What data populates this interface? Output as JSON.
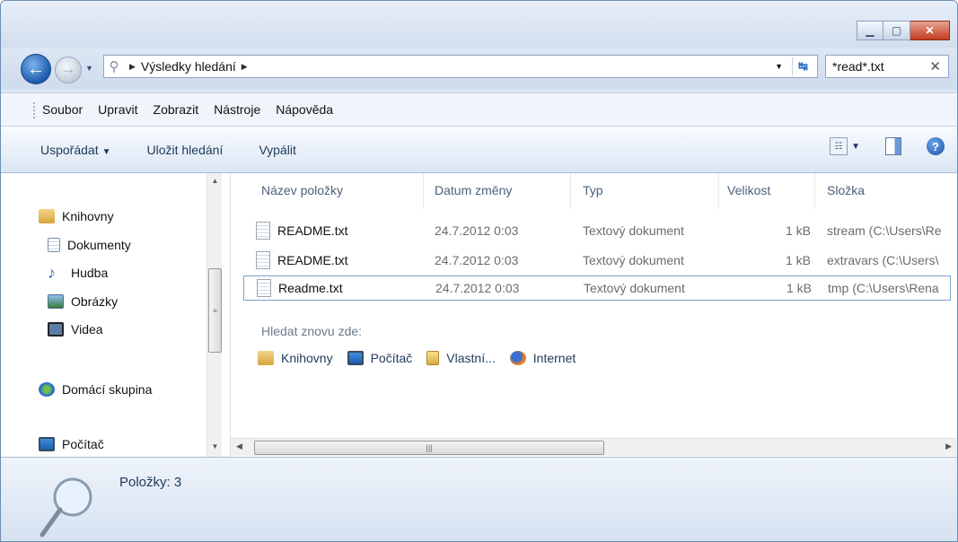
{
  "window": {
    "controls": [
      "minimize",
      "maximize",
      "close"
    ]
  },
  "address": {
    "path_label": "Výsledky hledání",
    "search_value": "*read*.txt"
  },
  "menu": [
    "Soubor",
    "Upravit",
    "Zobrazit",
    "Nástroje",
    "Nápověda"
  ],
  "commands": {
    "organize": "Uspořádat",
    "save_search": "Uložit hledání",
    "burn": "Vypálit"
  },
  "navpane": {
    "items": [
      {
        "label": "Knihovny",
        "icon": "libraries-icon"
      },
      {
        "label": "Dokumenty",
        "icon": "documents-icon"
      },
      {
        "label": "Hudba",
        "icon": "music-icon"
      },
      {
        "label": "Obrázky",
        "icon": "pictures-icon"
      },
      {
        "label": "Videa",
        "icon": "videos-icon"
      },
      {
        "label": "Domácí skupina",
        "icon": "homegroup-icon"
      },
      {
        "label": "Počítač",
        "icon": "computer-icon"
      }
    ]
  },
  "columns": [
    "Název položky",
    "Datum změny",
    "Typ",
    "Velikost",
    "Složka"
  ],
  "files": [
    {
      "name": "README.txt",
      "date": "24.7.2012 0:03",
      "type": "Textový dokument",
      "size": "1 kB",
      "folder": "stream (C:\\Users\\Re"
    },
    {
      "name": "README.txt",
      "date": "24.7.2012 0:03",
      "type": "Textový dokument",
      "size": "1 kB",
      "folder": "extravars (C:\\Users\\"
    },
    {
      "name": "Readme.txt",
      "date": "24.7.2012 0:03",
      "type": "Textový dokument",
      "size": "1 kB",
      "folder": "tmp (C:\\Users\\Rena"
    }
  ],
  "search_again": {
    "label": "Hledat znovu zde:",
    "targets": [
      "Knihovny",
      "Počítač",
      "Vlastní...",
      "Internet"
    ]
  },
  "status": {
    "items_text": "Položky: 3"
  },
  "colors": {
    "accent": "#1e395b",
    "selection_border": "#7da2ce",
    "close_button": "#c33c22"
  }
}
